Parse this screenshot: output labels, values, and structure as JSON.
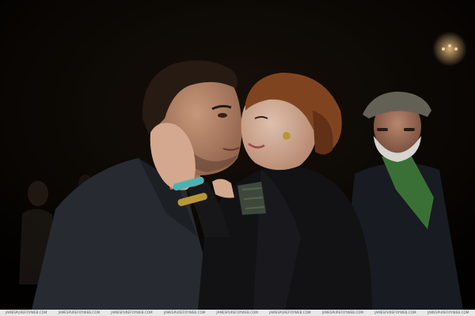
{
  "image": {
    "description_kind": "photograph"
  },
  "watermark": {
    "text": "JAMESPUREFOYWEB.COM",
    "repeat": 9,
    "colors": {
      "strip_bg": "#e8e8e8",
      "text": "#555555",
      "accent": "#7a9cc4"
    }
  }
}
